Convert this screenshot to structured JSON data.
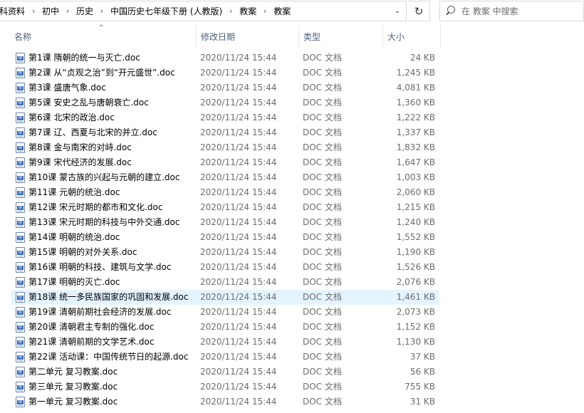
{
  "address": {
    "crumbs": [
      "科资料",
      "初中",
      "历史",
      "中国历史七年级下册 (人教版)",
      "教案",
      "教案"
    ]
  },
  "search": {
    "placeholder": "在 教案 中搜索"
  },
  "columns": {
    "name": "名称",
    "date": "修改日期",
    "type": "类型",
    "size": "大小"
  },
  "sort": {
    "column": "name",
    "direction": "ascending"
  },
  "files": [
    {
      "name": "第1课 隋朝的统一与灭亡.doc",
      "date": "2020/11/24 15:44",
      "type": "DOC 文档",
      "size": "24 KB"
    },
    {
      "name": "第2课 从“贞观之治”到“开元盛世”.doc",
      "date": "2020/11/24 15:44",
      "type": "DOC 文档",
      "size": "1,245 KB"
    },
    {
      "name": "第3课 盛唐气象.doc",
      "date": "2020/11/24 15:44",
      "type": "DOC 文档",
      "size": "4,081 KB"
    },
    {
      "name": "第5课 安史之乱与唐朝衰亡.doc",
      "date": "2020/11/24 15:44",
      "type": "DOC 文档",
      "size": "1,360 KB"
    },
    {
      "name": "第6课 北宋的政治.doc",
      "date": "2020/11/24 15:44",
      "type": "DOC 文档",
      "size": "1,222 KB"
    },
    {
      "name": "第7课 辽、西夏与北宋的并立.doc",
      "date": "2020/11/24 15:44",
      "type": "DOC 文档",
      "size": "1,337 KB"
    },
    {
      "name": "第8课 金与南宋的对峙.doc",
      "date": "2020/11/24 15:44",
      "type": "DOC 文档",
      "size": "1,832 KB"
    },
    {
      "name": "第9课 宋代经济的发展.doc",
      "date": "2020/11/24 15:44",
      "type": "DOC 文档",
      "size": "1,647 KB"
    },
    {
      "name": "第10课 蒙古族的兴起与元朝的建立.doc",
      "date": "2020/11/24 15:44",
      "type": "DOC 文档",
      "size": "1,003 KB"
    },
    {
      "name": "第11课 元朝的统治.doc",
      "date": "2020/11/24 15:44",
      "type": "DOC 文档",
      "size": "2,060 KB"
    },
    {
      "name": "第12课 宋元时期的都市和文化.doc",
      "date": "2020/11/24 15:44",
      "type": "DOC 文档",
      "size": "1,215 KB"
    },
    {
      "name": "第13课 宋元时期的科技与中外交通.doc",
      "date": "2020/11/24 15:44",
      "type": "DOC 文档",
      "size": "1,240 KB"
    },
    {
      "name": "第14课 明朝的统治.doc",
      "date": "2020/11/24 15:44",
      "type": "DOC 文档",
      "size": "1,552 KB"
    },
    {
      "name": "第15课 明朝的对外关系.doc",
      "date": "2020/11/24 15:44",
      "type": "DOC 文档",
      "size": "1,190 KB"
    },
    {
      "name": "第16课 明朝的科技、建筑与文学.doc",
      "date": "2020/11/24 15:44",
      "type": "DOC 文档",
      "size": "1,526 KB"
    },
    {
      "name": "第17课 明朝的灭亡.doc",
      "date": "2020/11/24 15:44",
      "type": "DOC 文档",
      "size": "2,076 KB"
    },
    {
      "name": "第18课 统一多民族国家的巩固和发展.doc",
      "date": "2020/11/24 15:44",
      "type": "DOC 文档",
      "size": "1,461 KB",
      "hover": true
    },
    {
      "name": "第19课 清朝前期社会经济的发展.doc",
      "date": "2020/11/24 15:44",
      "type": "DOC 文档",
      "size": "2,073 KB"
    },
    {
      "name": "第20课 清朝君主专制的强化.doc",
      "date": "2020/11/24 15:44",
      "type": "DOC 文档",
      "size": "1,152 KB"
    },
    {
      "name": "第21课 清朝前期的文学艺术.doc",
      "date": "2020/11/24 15:44",
      "type": "DOC 文档",
      "size": "1,130 KB"
    },
    {
      "name": "第22课 活动课：中国传统节日的起源.doc",
      "date": "2020/11/24 15:44",
      "type": "DOC 文档",
      "size": "37 KB"
    },
    {
      "name": "第二单元 复习教案.doc",
      "date": "2020/11/24 15:44",
      "type": "DOC 文档",
      "size": "56 KB"
    },
    {
      "name": "第三单元 复习教案.doc",
      "date": "2020/11/24 15:44",
      "type": "DOC 文档",
      "size": "755 KB"
    },
    {
      "name": "第一单元 复习教案.doc",
      "date": "2020/11/24 15:44",
      "type": "DOC 文档",
      "size": "31 KB"
    }
  ],
  "icons": {
    "file": "word-doc-icon",
    "refresh": "refresh-icon",
    "search": "search-icon"
  },
  "colors": {
    "hover_row": "#e5f3ff",
    "header_text": "#4c607a"
  }
}
